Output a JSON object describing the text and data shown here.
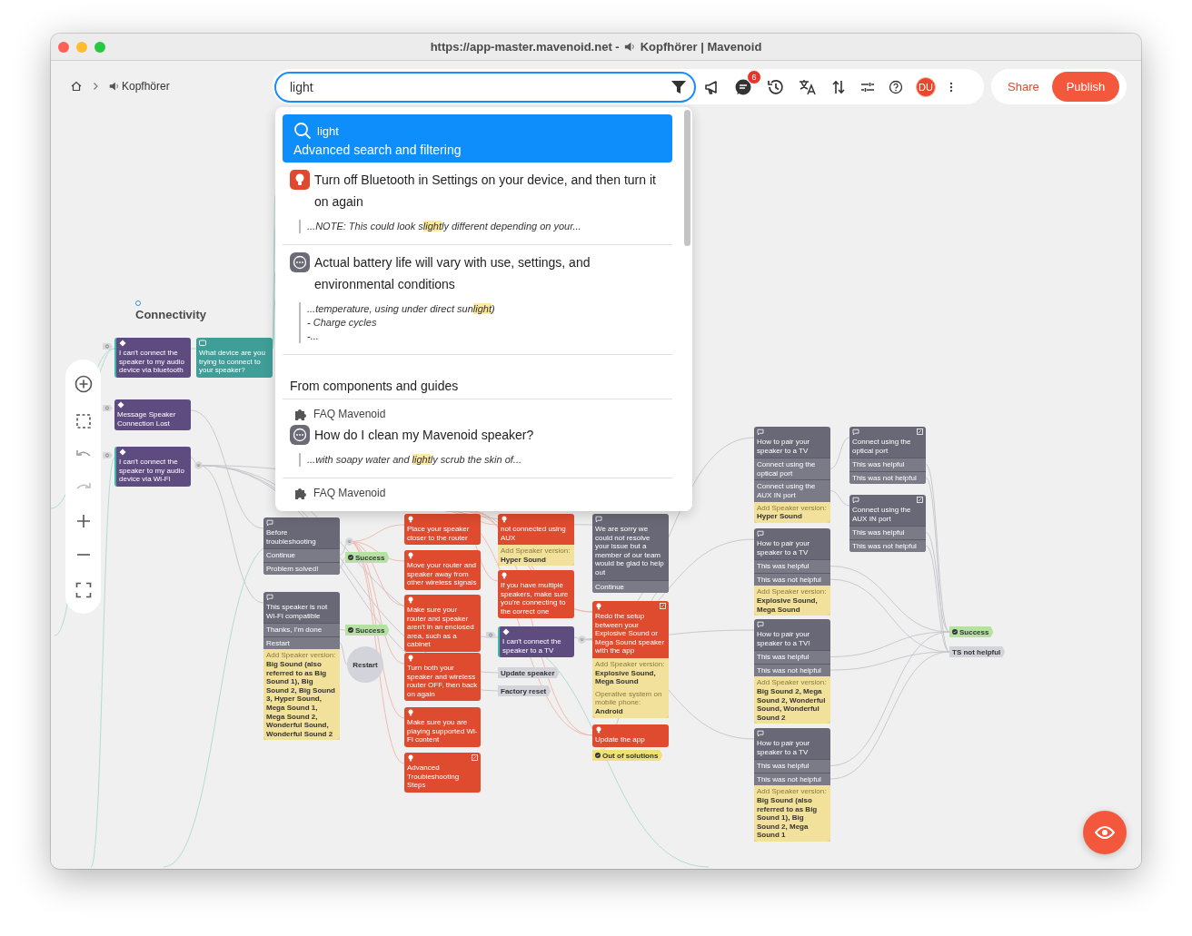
{
  "window": {
    "title_url": "https://app-master.mavenoid.net -",
    "title_name": "Kopfhörer | Mavenoid"
  },
  "breadcrumb": {
    "current": "Kopfhörer"
  },
  "search": {
    "value": "light"
  },
  "toolbar": {
    "notifications_badge": "6",
    "avatar": "DU"
  },
  "actions": [
    {
      "label": "Share",
      "kind": "text"
    },
    {
      "label": "Publish",
      "kind": "primary"
    }
  ],
  "search_results": {
    "highlight": {
      "query": "light",
      "label": "Advanced search and filtering",
      "selected": true
    },
    "results": [
      {
        "kind": "tip",
        "title": "Turn off Bluetooth in Settings on your device, and then turn it on again",
        "snippet": [
          "...NOTE: This could look s**light**ly different depending on your..."
        ]
      },
      {
        "kind": "message",
        "title": "Actual battery life will vary with use, settings, and environmental conditions",
        "snippet": [
          "...temperature, using under direct sun**light**)",
          "- Charge cycles",
          "-..."
        ]
      }
    ],
    "section_title": "From components and guides",
    "component_results": [
      {
        "source": "FAQ Mavenoid",
        "kind": "message",
        "title": "How do I clean my Mavenoid speaker?",
        "snippet": [
          "...with soapy water and **light**ly scrub the skin of..."
        ]
      },
      {
        "source": "FAQ Mavenoid"
      }
    ]
  },
  "canvas": {
    "group_label": "Connectivity",
    "nodes": [
      {
        "kind": "symptom",
        "entry": true,
        "linked": false,
        "title": "I can't connect the speaker to my audio device via bluetooth"
      },
      {
        "kind": "question",
        "entry": false,
        "linked": false,
        "title": "What device are you trying to connect to your speaker?"
      },
      {
        "kind": "symptom",
        "entry": false,
        "linked": false,
        "title": "Message Speaker Connection Lost"
      },
      {
        "kind": "symptom",
        "entry": true,
        "linked": false,
        "title": "I can't connect the speaker to my audio device via Wi-Fi"
      },
      {
        "kind": "message",
        "entry": false,
        "linked": false,
        "title": "Before troubleshooting",
        "options": [
          "Continue",
          "Problem solved!"
        ]
      },
      {
        "kind": "message",
        "entry": false,
        "linked": false,
        "title": "This speaker is not Wi-Fi compatible",
        "options": [
          "Thanks, I'm done",
          "Restart"
        ],
        "conditions": [
          {
            "label": "Add Speaker version:",
            "value": "Big Sound (also referred to as Big Sound 1), Big Sound 2, Big Sound 3, Hyper Sound, Mega Sound 1, Mega Sound 2, Wonderful Sound, Wonderful Sound 2"
          }
        ]
      },
      {
        "kind": "tip",
        "entry": false,
        "linked": false,
        "title": "Place your speaker closer to the router"
      },
      {
        "kind": "tip",
        "entry": false,
        "linked": false,
        "title": "Move your router and speaker away from other wireless signals"
      },
      {
        "kind": "tip",
        "entry": false,
        "linked": false,
        "title": "Make sure your router and speaker aren't in an enclosed area, such as a cabinet"
      },
      {
        "kind": "tip",
        "entry": false,
        "linked": false,
        "title": "Turn both your speaker and wireless router OFF, then back on again"
      },
      {
        "kind": "tip",
        "entry": false,
        "linked": false,
        "title": "Make sure you are playing supported Wi-Fi content"
      },
      {
        "kind": "tip",
        "entry": false,
        "linked": true,
        "title": "Advanced Troubleshooting Steps"
      },
      {
        "kind": "tip",
        "entry": false,
        "linked": false,
        "title": "not connected using AUX",
        "conditions": [
          {
            "label": "Add Speaker version:",
            "value": "Hyper Sound"
          }
        ]
      },
      {
        "kind": "tip",
        "entry": false,
        "linked": false,
        "title": "If you have multiple speakers, make sure you're connecting to the correct one"
      },
      {
        "kind": "symptom",
        "entry": true,
        "linked": false,
        "title": "I can't connect the speaker to a TV"
      },
      {
        "kind": "message",
        "entry": false,
        "linked": false,
        "title": "We are sorry we could not resolve your issue but a member of our team would be glad to help out",
        "options": [
          "Continue"
        ]
      },
      {
        "kind": "tip",
        "entry": false,
        "linked": true,
        "title": "Redo the setup between your Explosive Sound or Mega Sound speaker with the app",
        "conditions": [
          {
            "label": "Add Speaker version:",
            "value": "Explosive Sound, Mega Sound"
          },
          {
            "label": "Operative system on mobile phone:",
            "value": "Android"
          }
        ]
      },
      {
        "kind": "tip",
        "entry": false,
        "linked": false,
        "title": "Update the app"
      },
      {
        "kind": "message",
        "entry": false,
        "linked": false,
        "title": "How to pair your speaker to a TV",
        "options": [
          "Connect using the optical port",
          "Connect using the AUX IN port"
        ],
        "conditions": [
          {
            "label": "Add Speaker version:",
            "value": "Hyper Sound"
          }
        ]
      },
      {
        "kind": "message",
        "entry": false,
        "linked": true,
        "title": "Connect using the optical port",
        "options": [
          "This was helpful",
          "This was not helpful"
        ]
      },
      {
        "kind": "message",
        "entry": false,
        "linked": true,
        "title": "Connect using the AUX IN port",
        "options": [
          "This was helpful",
          "This was not helpful"
        ]
      },
      {
        "kind": "message",
        "entry": false,
        "linked": false,
        "title": "How to pair your speaker to a TV",
        "options": [
          "This was helpful",
          "This was not helpful"
        ],
        "conditions": [
          {
            "label": "Add Speaker version:",
            "value": "Explosive Sound, Mega Sound"
          }
        ]
      },
      {
        "kind": "message",
        "entry": false,
        "linked": false,
        "title": "How to pair your speaker to a TV!",
        "options": [
          "This was helpful",
          "This was not helpful"
        ],
        "conditions": [
          {
            "label": "Add Speaker version:",
            "value": "Big Sound 2, Mega Sound 2, Wonderful Sound, Wonderful Sound 2"
          }
        ]
      },
      {
        "kind": "message",
        "entry": false,
        "linked": false,
        "title": "How to pair your speaker to a TV",
        "options": [
          "This was helpful",
          "This was not helpful"
        ],
        "conditions": [
          {
            "label": "Add Speaker version:",
            "value": "Big Sound (also referred to as Big Sound 1), Big Sound 2, Mega Sound 1"
          }
        ]
      }
    ],
    "tags": [
      {
        "kind": "success",
        "text": "Success"
      },
      {
        "kind": "success",
        "text": "Success"
      },
      {
        "kind": "restart",
        "text": "Restart"
      },
      {
        "kind": "neutral",
        "text": "Update speaker"
      },
      {
        "kind": "neutral",
        "text": "Factory reset"
      },
      {
        "kind": "warning",
        "text": "Out of solutions"
      },
      {
        "kind": "success",
        "text": "Success"
      },
      {
        "kind": "neutral",
        "text": "TS not helpful"
      }
    ]
  }
}
